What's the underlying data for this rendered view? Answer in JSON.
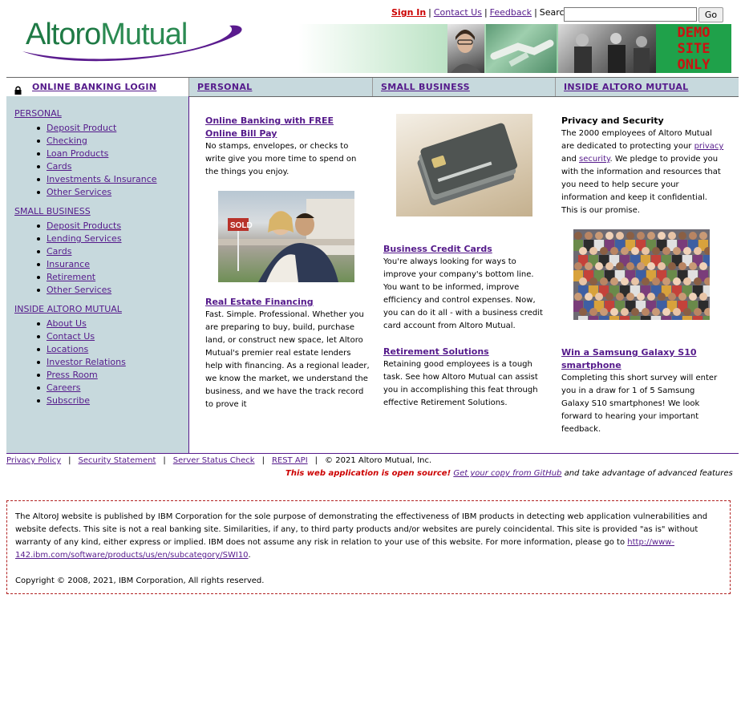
{
  "header": {
    "sign_in": "Sign In",
    "contact_us": "Contact Us",
    "feedback": "Feedback",
    "search_label": "Search",
    "search_value": "",
    "go_label": "Go",
    "logo_part1": "Altoro",
    "logo_part2": "Mutual",
    "demo_line1": "DEMO",
    "demo_line2": "SITE",
    "demo_line3": "ONLY"
  },
  "nav": {
    "login": "ONLINE BANKING LOGIN",
    "personal": "PERSONAL",
    "small_business": "SMALL BUSINESS",
    "inside": "INSIDE ALTORO MUTUAL"
  },
  "sidebar": {
    "personal_title": "PERSONAL",
    "personal_items": [
      "Deposit Product",
      "Checking",
      "Loan Products",
      "Cards",
      "Investments & Insurance",
      "Other Services"
    ],
    "business_title": "SMALL BUSINESS",
    "business_items": [
      "Deposit Products",
      "Lending Services",
      "Cards",
      "Insurance",
      "Retirement",
      "Other Services"
    ],
    "inside_title": "INSIDE ALTORO MUTUAL",
    "inside_items": [
      "About Us",
      "Contact Us",
      "Locations",
      "Investor Relations",
      "Press Room",
      "Careers",
      "Subscribe"
    ]
  },
  "content": {
    "col1": {
      "title1": "Online Banking with FREE Online Bill Pay",
      "text1": "No stamps, envelopes, or checks to write give you more time to spend on the things you enjoy.",
      "sign_sold": "SOLD",
      "title2": "Real Estate Financing",
      "text2": "Fast. Simple. Professional. Whether you are preparing to buy, build, purchase land, or construct new space, let Altoro Mutual's premier real estate lenders help with financing. As a regional leader, we know the market, we understand the business, and we have the track record to prove it"
    },
    "col2": {
      "title1": "Business Credit Cards",
      "text1": "You're always looking for ways to improve your company's bottom line. You want to be informed, improve efficiency and control expenses. Now, you can do it all - with a business credit card account from Altoro Mutual.",
      "title2": "Retirement Solutions",
      "text2": "Retaining good employees is a tough task. See how Altoro Mutual can assist you in accomplishing this feat through effective Retirement Solutions."
    },
    "col3": {
      "title1": "Privacy and Security",
      "text1_a": "The 2000 employees of Altoro Mutual are dedicated to protecting your ",
      "privacy_link": "privacy",
      "text1_and": " and ",
      "security_link": "security",
      "text1_b": ". We pledge to provide you with the information and resources that you need to help secure your information and keep it confidential. This is our promise.",
      "title2": "Win a Samsung Galaxy S10 smartphone",
      "text2": "Completing this short survey will enter you in a draw for 1 of 5 Samsung Galaxy S10 smartphones! We look forward to hearing your important feedback."
    }
  },
  "footer": {
    "privacy_policy": "Privacy Policy",
    "security_statement": "Security Statement",
    "server_status": "Server Status Check",
    "rest_api": "REST API",
    "copyright": "© 2021 Altoro Mutual, Inc.",
    "open_source": "This web application is open source!",
    "github_link": "Get your copy from GitHub",
    "github_tail": " and take advantage of advanced features"
  },
  "disclaimer": {
    "text": "The AltoroJ website is published by IBM Corporation for the sole purpose of demonstrating the effectiveness of IBM products in detecting web application vulnerabilities and website defects. This site is not a real banking site. Similarities, if any, to third party products and/or websites are purely coincidental. This site is provided \"as is\" without warranty of any kind, either express or implied. IBM does not assume any risk in relation to your use of this website. For more information, please go to ",
    "link": "http://www-142.ibm.com/software/products/us/en/subcategory/SWI10",
    "period": ".",
    "copyright": "Copyright © 2008, 2021, IBM Corporation, All rights reserved."
  }
}
